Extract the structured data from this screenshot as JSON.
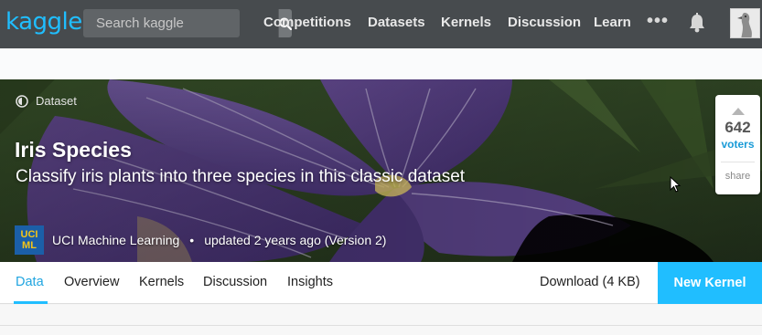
{
  "nav": {
    "logo": "kaggle",
    "search_placeholder": "Search kaggle",
    "links": [
      "Competitions",
      "Datasets",
      "Kernels",
      "Discussion",
      "Learn"
    ],
    "more": "•••",
    "icons": [
      "search-icon",
      "bell-icon",
      "user-avatar"
    ]
  },
  "hero": {
    "type_label": "Dataset",
    "title": "Iris Species",
    "subtitle": "Classify iris plants into three species in this classic dataset",
    "org_logo_line1": "UCI",
    "org_logo_line2": "ML",
    "owner": "UCI Machine Learning",
    "separator": "•",
    "updated": "updated 2 years ago (Version 2)"
  },
  "vote": {
    "count": "642",
    "label": "voters",
    "share": "share"
  },
  "tabs": {
    "items": [
      "Data",
      "Overview",
      "Kernels",
      "Discussion",
      "Insights"
    ],
    "active": "Data",
    "download": "Download (4 KB)",
    "new_kernel": "New Kernel"
  },
  "colors": {
    "accent": "#20beff",
    "nav_bg": "#474b4e",
    "active_tab": "#20a5e0"
  }
}
